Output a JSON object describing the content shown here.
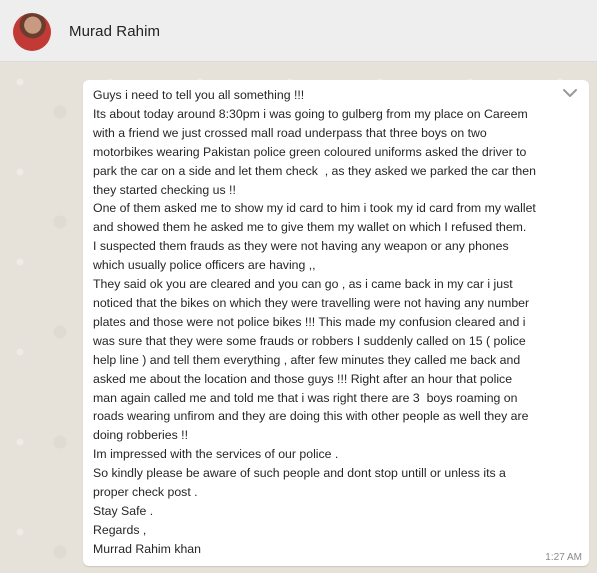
{
  "header": {
    "contact_name": "Murad Rahim"
  },
  "message": {
    "lines": [
      "Guys i need to tell you all something !!!",
      "Its about today around 8:30pm i was going to gulberg from my place on Careem",
      "with a friend we just crossed mall road underpass that three boys on two",
      "motorbikes wearing Pakistan police green coloured uniforms asked the driver to",
      "park the car on a side and let them check  , as they asked we parked the car then",
      "they started checking us !!",
      "One of them asked me to show my id card to him i took my id card from my wallet",
      "and showed them he asked me to give them my wallet on which I refused them.",
      "I suspected them frauds as they were not having any weapon or any phones",
      "which usually police officers are having ,,",
      "They said ok you are cleared and you can go , as i came back in my car i just",
      "noticed that the bikes on which they were travelling were not having any number",
      "plates and those were not police bikes !!! This made my confusion cleared and i",
      "was sure that they were some frauds or robbers I suddenly called on 15 ( police",
      "help line ) and tell them everything , after few minutes they called me back and",
      "asked me about the location and those guys !!! Right after an hour that police",
      "man again called me and told me that i was right there are 3  boys roaming on",
      "roads wearing unfirom and they are doing this with other people as well they are",
      "doing robberies !!",
      "Im impressed with the services of our police .",
      "So kindly please be aware of such people and dont stop untill or unless its a",
      "proper check post .",
      "Stay Safe .",
      "Regards ,",
      "Murrad Rahim khan"
    ],
    "time": "1:27 AM"
  },
  "icons": {
    "menu": "chevron-down-icon"
  }
}
